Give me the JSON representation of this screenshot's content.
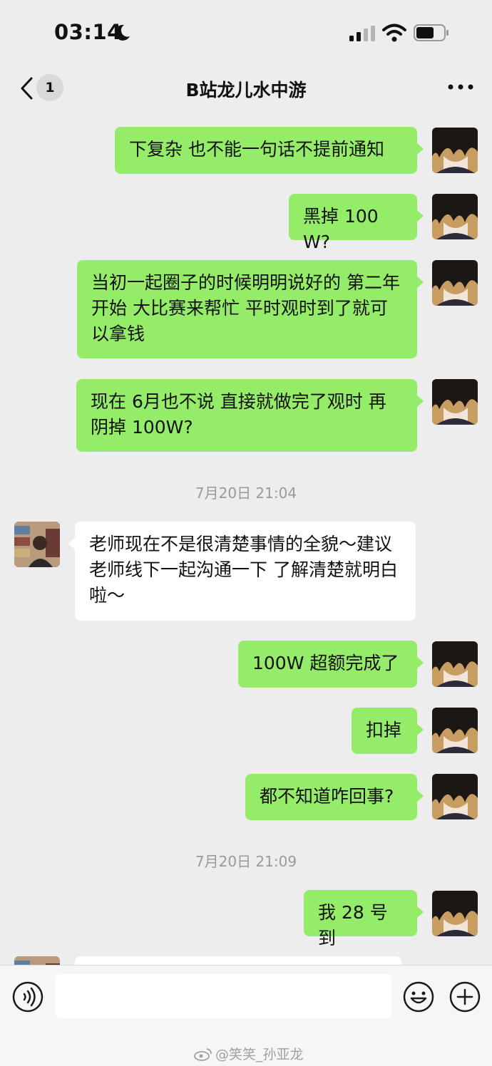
{
  "status_bar": {
    "time": "03:14"
  },
  "nav": {
    "title": "B站龙儿水中游",
    "unread_count": "1"
  },
  "messages": [
    {
      "side": "mine",
      "text": "下复杂 也不能一句话不提前通知"
    },
    {
      "side": "mine",
      "text": "黑掉 100W?"
    },
    {
      "side": "mine",
      "text": "当初一起圈子的时候明明说好的 第二年开始 大比赛来帮忙 平时观时到了就可以拿钱"
    },
    {
      "side": "mine",
      "text": "现在 6月也不说 直接就做完了观时 再阴掉 100W?"
    },
    {
      "timestamp": "7月20日 21:04"
    },
    {
      "side": "theirs",
      "text": "老师现在不是很清楚事情的全貌～建议老师线下一起沟通一下 了解清楚就明白啦～"
    },
    {
      "side": "mine",
      "text": "100W 超额完成了"
    },
    {
      "side": "mine",
      "text": "扣掉"
    },
    {
      "side": "mine",
      "text": "都不知道咋回事?"
    },
    {
      "timestamp": "7月20日 21:09"
    },
    {
      "side": "mine",
      "text": "我 28 号到"
    }
  ],
  "watermark": "@笑笑_孙亚龙",
  "colors": {
    "background": "#ededed",
    "my_bubble": "#95ec69",
    "their_bubble": "#ffffff",
    "timestamp": "#9a9a9a"
  },
  "icons": [
    "back-chevron-icon",
    "more-dots-icon",
    "voice-icon",
    "emoji-icon",
    "plus-icon",
    "moon-icon",
    "signal-icon",
    "wifi-icon",
    "battery-icon",
    "weibo-icon"
  ]
}
